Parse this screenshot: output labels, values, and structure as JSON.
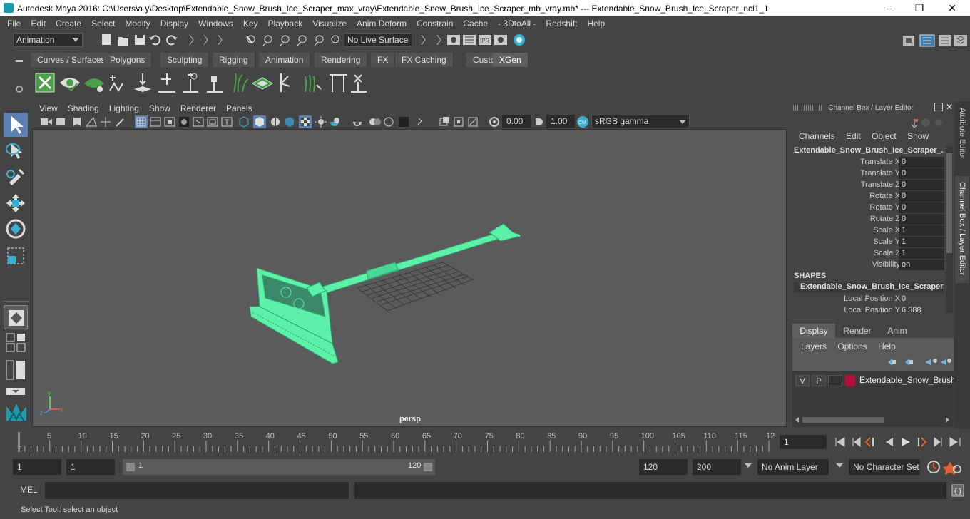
{
  "titlebar": {
    "title": "Autodesk Maya 2016: C:\\Users\\a y\\Desktop\\Extendable_Snow_Brush_Ice_Scraper_max_vray\\Extendable_Snow_Brush_Ice_Scraper_mb_vray.mb*   ---   Extendable_Snow_Brush_Ice_Scraper_ncl1_1",
    "minimize": "–",
    "maximize": "❐",
    "close": "✕"
  },
  "menubar": [
    "File",
    "Edit",
    "Create",
    "Select",
    "Modify",
    "Display",
    "Windows",
    "Key",
    "Playback",
    "Visualize",
    "Anim Deform",
    "Constrain",
    "Cache",
    "- 3DtoAll -",
    "Redshift",
    "Help"
  ],
  "statusline": {
    "menuset": "Animation",
    "live_surface": "No Live Surface"
  },
  "shelf": {
    "tabs": [
      "Curves / Surfaces",
      "Polygons",
      "Sculpting",
      "Rigging",
      "Animation",
      "Rendering",
      "FX",
      "FX Caching",
      "Custom",
      "XGen"
    ],
    "active_tab": "XGen"
  },
  "viewport": {
    "menus": [
      "View",
      "Shading",
      "Lighting",
      "Show",
      "Renderer",
      "Panels"
    ],
    "exposure": "0.00",
    "gamma": "1.00",
    "colorspace": "sRGB gamma",
    "camera": "persp",
    "model_color": "#5cf0a8"
  },
  "channelbox": {
    "header": "Channel Box / Layer Editor",
    "menus": [
      "Channels",
      "Edit",
      "Object",
      "Show"
    ],
    "object_name": "Extendable_Snow_Brush_Ice_Scraper_...",
    "channels": [
      {
        "label": "Translate X",
        "value": "0"
      },
      {
        "label": "Translate Y",
        "value": "0"
      },
      {
        "label": "Translate Z",
        "value": "0"
      },
      {
        "label": "Rotate X",
        "value": "0"
      },
      {
        "label": "Rotate Y",
        "value": "0"
      },
      {
        "label": "Rotate Z",
        "value": "0"
      },
      {
        "label": "Scale X",
        "value": "1"
      },
      {
        "label": "Scale Y",
        "value": "1"
      },
      {
        "label": "Scale Z",
        "value": "1"
      },
      {
        "label": "Visibility",
        "value": "on"
      }
    ],
    "shapes_header": "SHAPES",
    "shape_name": "Extendable_Snow_Brush_Ice_Scraper...",
    "shape_channels": [
      {
        "label": "Local Position X",
        "value": "0"
      },
      {
        "label": "Local Position Y",
        "value": "6.588"
      }
    ],
    "layer_tabs": [
      "Display",
      "Render",
      "Anim"
    ],
    "active_layer_tab": "Display",
    "layer_menus": [
      "Layers",
      "Options",
      "Help"
    ],
    "layer": {
      "v": "V",
      "p": "P",
      "name": "Extendable_Snow_Brush",
      "color": "#b0103a"
    }
  },
  "side_tabs": [
    "Attribute Editor",
    "Channel Box / Layer Editor"
  ],
  "timeline": {
    "ticks": [
      "5",
      "10",
      "15",
      "20",
      "25",
      "30",
      "35",
      "40",
      "45",
      "50",
      "55",
      "60",
      "65",
      "70",
      "75",
      "80",
      "85",
      "90",
      "95",
      "100",
      "105",
      "110",
      "115",
      "12"
    ],
    "start_marker": "1",
    "current_frame": "1"
  },
  "range": {
    "start": "1",
    "playback_start": "1",
    "slider_start": "1",
    "slider_end": "120",
    "playback_end": "120",
    "end": "200",
    "anim_layer": "No Anim Layer",
    "character_set": "No Character Set"
  },
  "cmdline": {
    "label": "MEL"
  },
  "helpline": {
    "text": "Select Tool: select an object"
  }
}
